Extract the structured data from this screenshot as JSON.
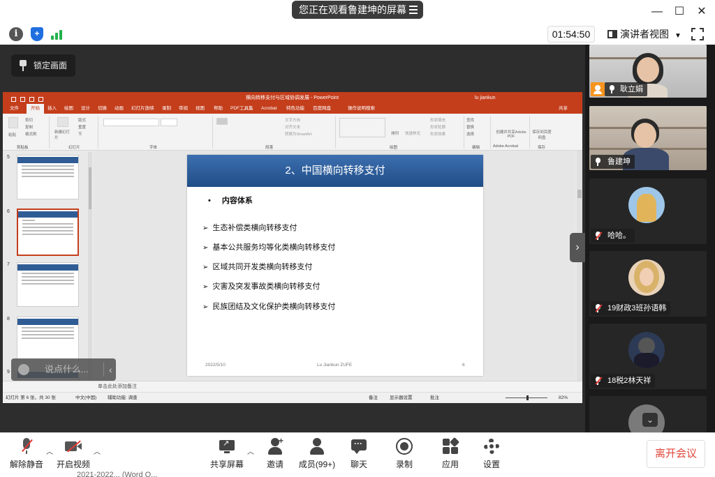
{
  "app": {
    "banner": "您正在观看鲁建坤的屏幕",
    "timer": "01:54:50",
    "view_mode": "演讲者视图",
    "lock_screen": "锁定画面",
    "collapse_arrow": "›",
    "icons": [
      "menu-icon",
      "minimize-icon",
      "maximize-icon",
      "close-icon",
      "info-icon",
      "security-shield-icon",
      "signal-bars-icon",
      "speaker-view-icon",
      "fullscreen-icon",
      "pin-icon"
    ],
    "colors": {
      "accent": "#1f6fe0",
      "signal": "#22b14c",
      "danger": "#e0463a",
      "host": "#f7941d",
      "ppt": "#c43e1c"
    }
  },
  "ppt": {
    "window_title": "横向转移支付与区域协调发展 - PowerPoint",
    "user": "lu jiankun",
    "tabs": [
      "文件",
      "开始",
      "插入",
      "绘图",
      "设计",
      "切换",
      "动画",
      "幻灯片放映",
      "录制",
      "审阅",
      "视图",
      "帮助",
      "PDF工具集",
      "Acrobat",
      "特色功能",
      "百度网盘",
      "操作说明搜索",
      "共享"
    ],
    "active_tab": "开始",
    "ribbon_groups": [
      "剪贴板",
      "幻灯片",
      "字体",
      "段落",
      "绘图",
      "编辑",
      "Adobe Acrobat",
      "保存"
    ],
    "ribbon_items": {
      "paste": "粘贴",
      "cut": "剪切",
      "copy": "复制",
      "format_painter": "格式刷",
      "new_slide": "新建幻灯片",
      "layout": "版式",
      "reset": "重置",
      "section": "节",
      "find": "查找",
      "replace": "替换",
      "select": "选择",
      "create_pdf": "创建并共享Adobe PDF",
      "save_baidu": "保存到百度网盘",
      "arrange": "排列",
      "quick_styles": "快速样式",
      "text_direction": "文字方向",
      "align_text": "对齐文本",
      "smartart": "转换为SmartArt",
      "shape_fill": "形状填充",
      "shape_outline": "形状轮廓",
      "shape_effect": "形状效果"
    },
    "thumb_numbers": [
      "5",
      "6",
      "7",
      "8",
      "9"
    ],
    "slide": {
      "title": "2、中国横向转移支付",
      "bullet": "内容体系",
      "items": [
        "生态补偿类横向转移支付",
        "基本公共服务均等化类横向转移支付",
        "区域共同开发类横向转移支付",
        "灾害及突发事故类横向转移支付",
        "民族团结及文化保护类横向转移支付"
      ],
      "footer_date": "2022/5/10",
      "footer_author": "Lu Jiankun ZUFE",
      "footer_page": "6"
    },
    "notes_placeholder": "单击此处添加备注",
    "status": {
      "slide_info": "幻灯片 第 6 张，共 30 张",
      "language": "中文(中国)",
      "accessibility": "辅助功能: 调查",
      "notes": "备注",
      "display_settings": "显示器设置",
      "comments": "批注",
      "zoom": "82%"
    }
  },
  "chat": {
    "placeholder": "说点什么..."
  },
  "gallery": [
    {
      "name": "耿立娟",
      "muted": false,
      "host": true,
      "type": "video"
    },
    {
      "name": "鲁建坤",
      "muted": false,
      "host": false,
      "type": "video"
    },
    {
      "name": "哈哈。",
      "muted": true,
      "host": false,
      "type": "avatar"
    },
    {
      "name": "19财政3班孙语韩",
      "muted": true,
      "host": false,
      "type": "avatar"
    },
    {
      "name": "18税2林天祥",
      "muted": true,
      "host": false,
      "type": "avatar"
    }
  ],
  "controls": {
    "unmute": "解除静音",
    "start_video": "开启视频",
    "share_screen": "共享屏幕",
    "invite": "邀请",
    "members": "成员(99+)",
    "chat": "聊天",
    "record": "录制",
    "apps": "应用",
    "settings": "设置",
    "leave": "离开会议",
    "bottom_overflow": "2021-2022...    (Word Q..."
  }
}
